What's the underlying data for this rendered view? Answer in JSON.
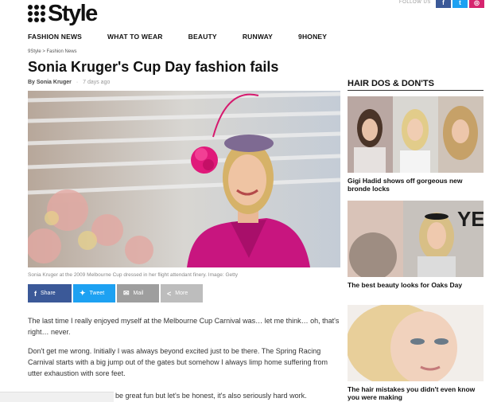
{
  "header": {
    "logo_text": "Style",
    "follow_label": "FOLLOW US",
    "social": [
      {
        "icon": "facebook-icon",
        "glyph": "f",
        "color": "#3b5998"
      },
      {
        "icon": "twitter-icon",
        "glyph": "t",
        "color": "#1da1f2"
      },
      {
        "icon": "instagram-icon",
        "glyph": "◎",
        "color": "#d6246e"
      }
    ]
  },
  "nav": {
    "items": [
      "FASHION NEWS",
      "WHAT TO WEAR",
      "BEAUTY",
      "RUNWAY",
      "9HONEY"
    ]
  },
  "article": {
    "breadcrumb": "9Style > Fashion News",
    "title": "Sonia Kruger's Cup Day fashion fails",
    "author": "By Sonia Kruger",
    "separator": "·",
    "time": "7 days ago",
    "caption": "Sonia Kruger at the 2009 Melbourne Cup dressed in her flight attendant finery. Image: Getty",
    "share": {
      "facebook": "Share",
      "twitter": "Tweet",
      "mail": "Mail",
      "more": "More"
    },
    "paragraphs": [
      "The last time I really enjoyed myself at the Melbourne Cup Carnival was… let me think… oh, that's right… never.",
      "Don't get me wrong. Initially I was always beyond excited just to be there. The Spring Racing Carnival starts with a big jump out of the gates but somehow I always limp home suffering from utter exhaustion with sore feet.",
      "be great fun but let's be honest, it's also seriously hard work."
    ]
  },
  "sidebar": {
    "heading": "HAIR DOS & DON'TS",
    "items": [
      {
        "caption": "Gigi Hadid shows off gorgeous new bronde locks"
      },
      {
        "caption": "The best beauty looks for Oaks Day"
      },
      {
        "caption": "The hair mistakes you didn't even know you were making"
      }
    ]
  }
}
